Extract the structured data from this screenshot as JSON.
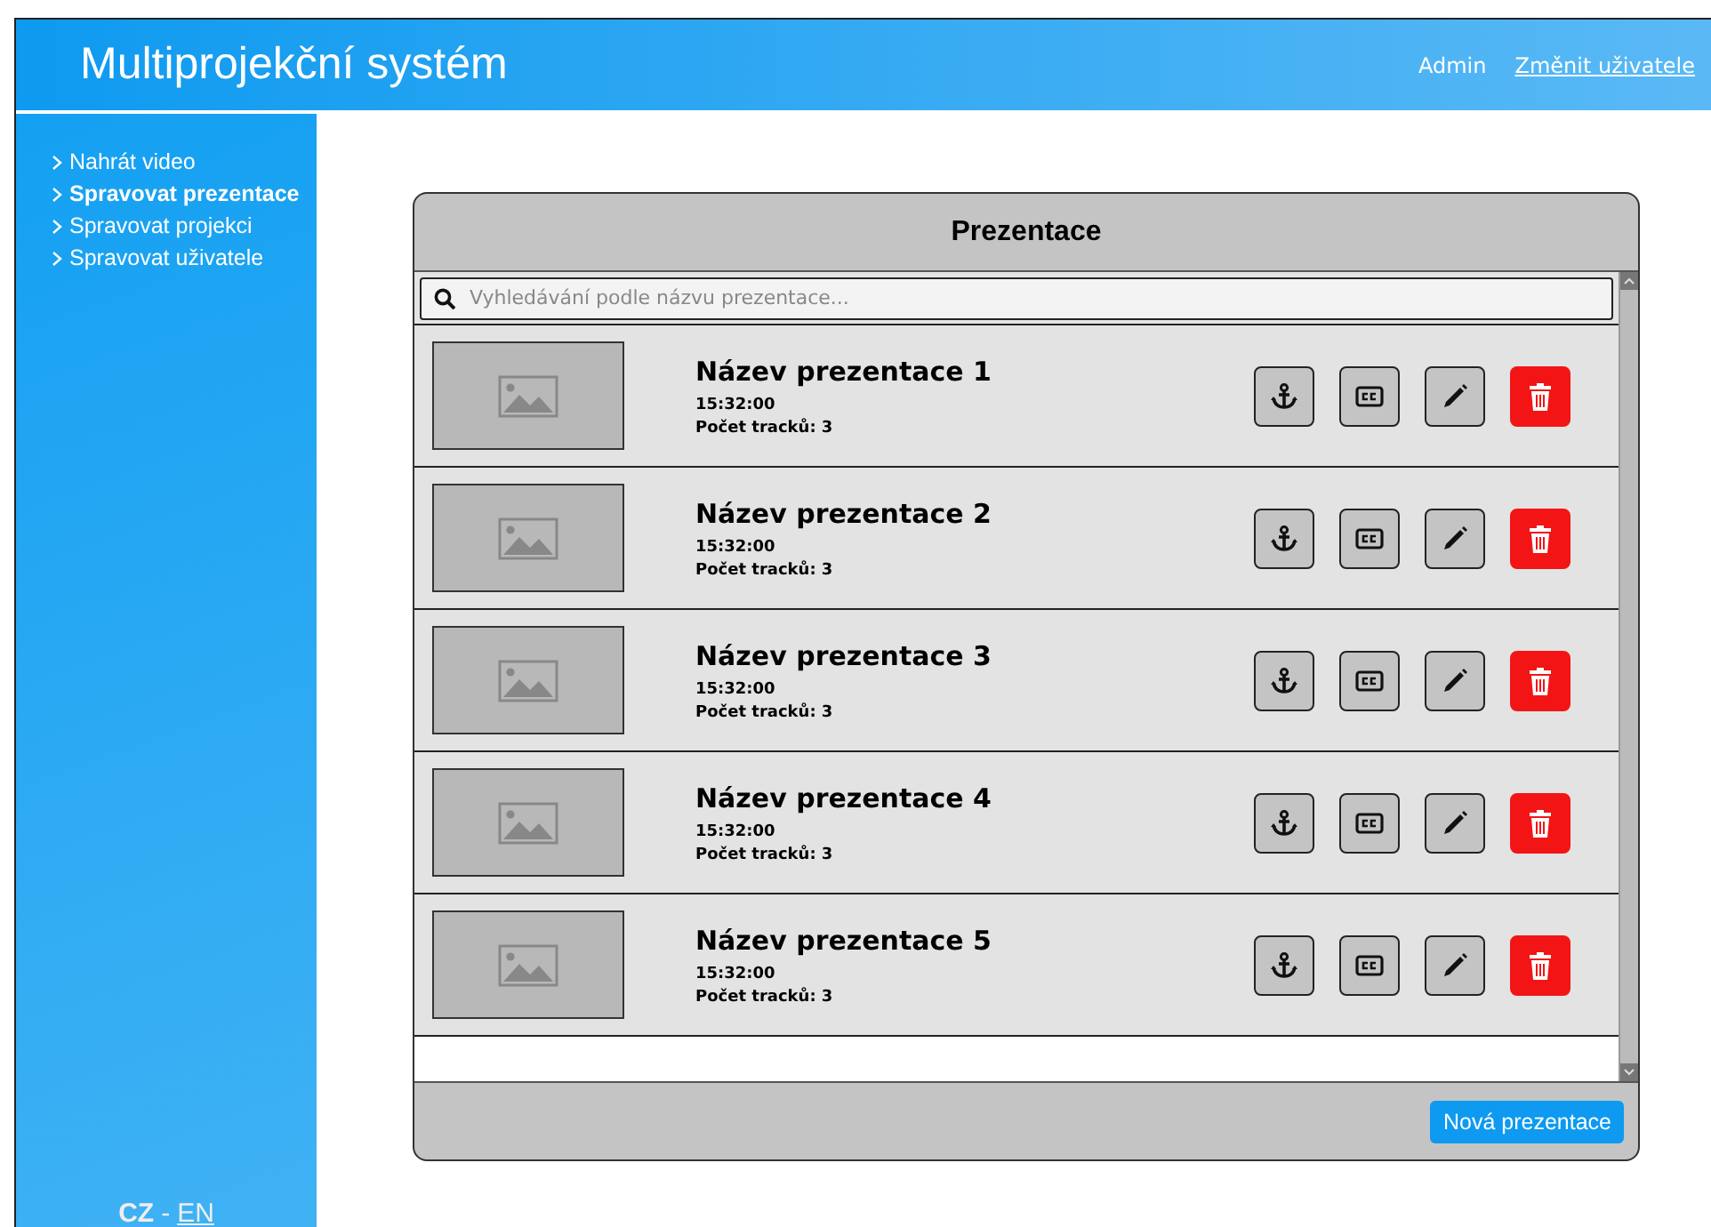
{
  "header": {
    "title": "Multiprojekční systém",
    "user": "Admin",
    "switch_user": "Změnit uživatele"
  },
  "sidebar": {
    "items": [
      {
        "label": "Nahrát video",
        "selected": false
      },
      {
        "label": "Spravovat prezentace",
        "selected": true
      },
      {
        "label": "Spravovat projekci",
        "selected": false
      },
      {
        "label": "Spravovat uživatele",
        "selected": false
      }
    ],
    "languages": [
      {
        "label": "CZ",
        "selected": true
      },
      {
        "label": "EN",
        "selected": false
      }
    ],
    "language_separator": "-"
  },
  "panel": {
    "title": "Prezentace",
    "search": {
      "placeholder": "Vyhledávání podle názvu prezentace..."
    },
    "presentations": [
      {
        "name": "Název prezentace 1",
        "time": "15:32:00",
        "tracks": "Počet tracků: 3"
      },
      {
        "name": "Název prezentace 2",
        "time": "15:32:00",
        "tracks": "Počet tracků: 3"
      },
      {
        "name": "Název prezentace 3",
        "time": "15:32:00",
        "tracks": "Počet tracků: 3"
      },
      {
        "name": "Název prezentace 4",
        "time": "15:32:00",
        "tracks": "Počet tracků: 3"
      },
      {
        "name": "Název prezentace 5",
        "time": "15:32:00",
        "tracks": "Počet tracků: 3"
      }
    ],
    "new_button": "Nová prezentace"
  }
}
